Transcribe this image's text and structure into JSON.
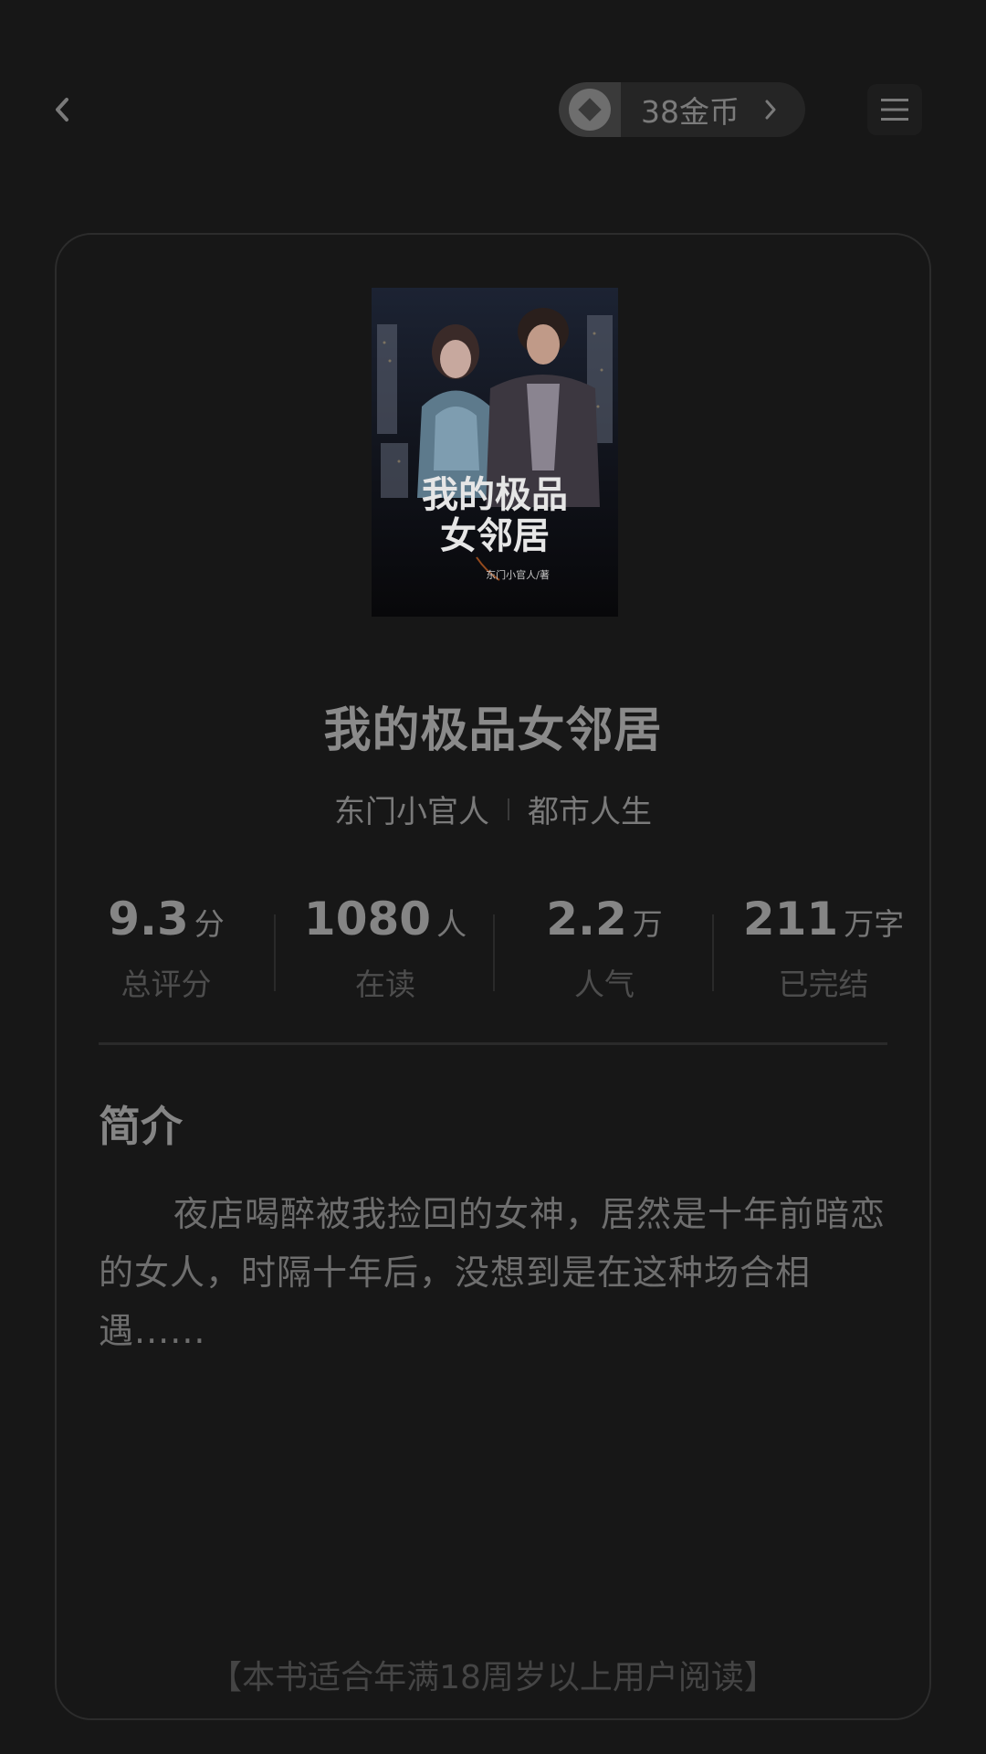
{
  "header": {
    "coins_label": "38金币"
  },
  "book": {
    "title": "我的极品女邻居",
    "author": "东门小官人",
    "category": "都市人生",
    "cover": {
      "title_line1": "我的极品",
      "title_line2": "女邻居",
      "author_credit": "东门小官人/著"
    }
  },
  "stats": [
    {
      "value": "9.3",
      "unit": "分",
      "label": "总评分"
    },
    {
      "value": "1080",
      "unit": "人",
      "label": "在读"
    },
    {
      "value": "2.2",
      "unit": "万",
      "label": "人气"
    },
    {
      "value": "211",
      "unit": "万字",
      "label": "已完结"
    }
  ],
  "intro": {
    "heading": "简介",
    "text": "夜店喝醉被我捡回的女神，居然是十年前暗恋的女人，时隔十年后，没想到是在这种场合相遇......"
  },
  "footer": {
    "age_note": "【本书适合年满18周岁以上用户阅读】"
  },
  "colors": {
    "background": "#171717",
    "card_border": "#2c2c2c",
    "pill_background": "#252525"
  }
}
